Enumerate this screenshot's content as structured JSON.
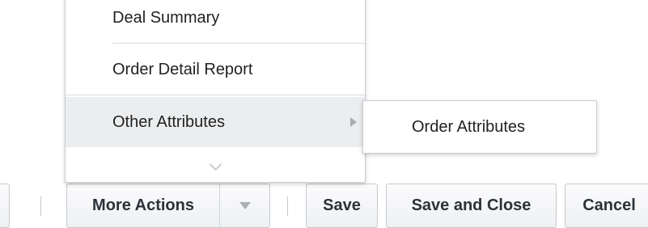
{
  "menu": {
    "items": [
      {
        "label": "Deal Summary"
      },
      {
        "label": "Order Detail Report"
      },
      {
        "label": "Other Attributes",
        "has_submenu": true,
        "highlighted": true
      }
    ],
    "scroll_icon": "chevron-down-icon"
  },
  "submenu": {
    "items": [
      {
        "label": "Order Attributes"
      }
    ]
  },
  "toolbar": {
    "more_actions_label": "More Actions",
    "more_actions_arrow_icon": "triangle-down-icon",
    "save_label": "Save",
    "save_close_label": "Save and Close",
    "cancel_label": "Cancel"
  },
  "colors": {
    "menu_highlight": "#ebedef",
    "border": "#c4c9ce",
    "text": "#222222"
  }
}
